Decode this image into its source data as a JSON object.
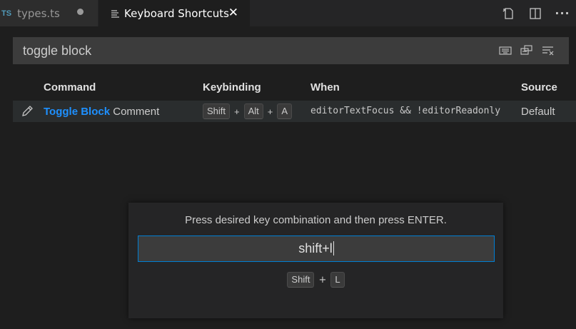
{
  "tabs": [
    {
      "badge": "TS",
      "label": "types.ts",
      "active": false,
      "dirty": true
    },
    {
      "label": "Keyboard Shortcuts",
      "active": true,
      "close": "✕"
    }
  ],
  "toolbar": {
    "more": "···"
  },
  "search": {
    "value": "toggle block"
  },
  "table": {
    "headers": {
      "command": "Command",
      "keybinding": "Keybinding",
      "when": "When",
      "source": "Source"
    },
    "row": {
      "command_highlight": "Toggle Block",
      "command_rest": " Comment",
      "keys": [
        "Shift",
        "Alt",
        "A"
      ],
      "plus": "+",
      "when": "editorTextFocus && !editorReadonly",
      "source": "Default"
    }
  },
  "dialog": {
    "message": "Press desired key combination and then press ENTER.",
    "input_value": "shift+l",
    "preview_keys": [
      "Shift",
      "L"
    ],
    "plus": "+"
  },
  "colors": {
    "accent": "#007fd4",
    "highlight": "#1e90ff",
    "background": "#1e1e1e"
  }
}
